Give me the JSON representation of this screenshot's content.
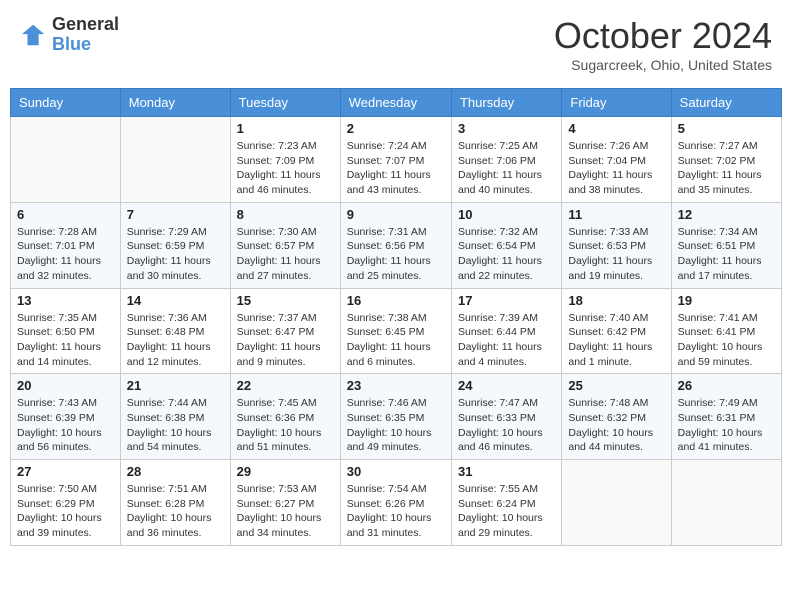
{
  "header": {
    "logo_general": "General",
    "logo_blue": "Blue",
    "title": "October 2024",
    "location": "Sugarcreek, Ohio, United States"
  },
  "days_of_week": [
    "Sunday",
    "Monday",
    "Tuesday",
    "Wednesday",
    "Thursday",
    "Friday",
    "Saturday"
  ],
  "weeks": [
    [
      {
        "day": "",
        "sunrise": "",
        "sunset": "",
        "daylight": ""
      },
      {
        "day": "",
        "sunrise": "",
        "sunset": "",
        "daylight": ""
      },
      {
        "day": "1",
        "sunrise": "Sunrise: 7:23 AM",
        "sunset": "Sunset: 7:09 PM",
        "daylight": "Daylight: 11 hours and 46 minutes."
      },
      {
        "day": "2",
        "sunrise": "Sunrise: 7:24 AM",
        "sunset": "Sunset: 7:07 PM",
        "daylight": "Daylight: 11 hours and 43 minutes."
      },
      {
        "day": "3",
        "sunrise": "Sunrise: 7:25 AM",
        "sunset": "Sunset: 7:06 PM",
        "daylight": "Daylight: 11 hours and 40 minutes."
      },
      {
        "day": "4",
        "sunrise": "Sunrise: 7:26 AM",
        "sunset": "Sunset: 7:04 PM",
        "daylight": "Daylight: 11 hours and 38 minutes."
      },
      {
        "day": "5",
        "sunrise": "Sunrise: 7:27 AM",
        "sunset": "Sunset: 7:02 PM",
        "daylight": "Daylight: 11 hours and 35 minutes."
      }
    ],
    [
      {
        "day": "6",
        "sunrise": "Sunrise: 7:28 AM",
        "sunset": "Sunset: 7:01 PM",
        "daylight": "Daylight: 11 hours and 32 minutes."
      },
      {
        "day": "7",
        "sunrise": "Sunrise: 7:29 AM",
        "sunset": "Sunset: 6:59 PM",
        "daylight": "Daylight: 11 hours and 30 minutes."
      },
      {
        "day": "8",
        "sunrise": "Sunrise: 7:30 AM",
        "sunset": "Sunset: 6:57 PM",
        "daylight": "Daylight: 11 hours and 27 minutes."
      },
      {
        "day": "9",
        "sunrise": "Sunrise: 7:31 AM",
        "sunset": "Sunset: 6:56 PM",
        "daylight": "Daylight: 11 hours and 25 minutes."
      },
      {
        "day": "10",
        "sunrise": "Sunrise: 7:32 AM",
        "sunset": "Sunset: 6:54 PM",
        "daylight": "Daylight: 11 hours and 22 minutes."
      },
      {
        "day": "11",
        "sunrise": "Sunrise: 7:33 AM",
        "sunset": "Sunset: 6:53 PM",
        "daylight": "Daylight: 11 hours and 19 minutes."
      },
      {
        "day": "12",
        "sunrise": "Sunrise: 7:34 AM",
        "sunset": "Sunset: 6:51 PM",
        "daylight": "Daylight: 11 hours and 17 minutes."
      }
    ],
    [
      {
        "day": "13",
        "sunrise": "Sunrise: 7:35 AM",
        "sunset": "Sunset: 6:50 PM",
        "daylight": "Daylight: 11 hours and 14 minutes."
      },
      {
        "day": "14",
        "sunrise": "Sunrise: 7:36 AM",
        "sunset": "Sunset: 6:48 PM",
        "daylight": "Daylight: 11 hours and 12 minutes."
      },
      {
        "day": "15",
        "sunrise": "Sunrise: 7:37 AM",
        "sunset": "Sunset: 6:47 PM",
        "daylight": "Daylight: 11 hours and 9 minutes."
      },
      {
        "day": "16",
        "sunrise": "Sunrise: 7:38 AM",
        "sunset": "Sunset: 6:45 PM",
        "daylight": "Daylight: 11 hours and 6 minutes."
      },
      {
        "day": "17",
        "sunrise": "Sunrise: 7:39 AM",
        "sunset": "Sunset: 6:44 PM",
        "daylight": "Daylight: 11 hours and 4 minutes."
      },
      {
        "day": "18",
        "sunrise": "Sunrise: 7:40 AM",
        "sunset": "Sunset: 6:42 PM",
        "daylight": "Daylight: 11 hours and 1 minute."
      },
      {
        "day": "19",
        "sunrise": "Sunrise: 7:41 AM",
        "sunset": "Sunset: 6:41 PM",
        "daylight": "Daylight: 10 hours and 59 minutes."
      }
    ],
    [
      {
        "day": "20",
        "sunrise": "Sunrise: 7:43 AM",
        "sunset": "Sunset: 6:39 PM",
        "daylight": "Daylight: 10 hours and 56 minutes."
      },
      {
        "day": "21",
        "sunrise": "Sunrise: 7:44 AM",
        "sunset": "Sunset: 6:38 PM",
        "daylight": "Daylight: 10 hours and 54 minutes."
      },
      {
        "day": "22",
        "sunrise": "Sunrise: 7:45 AM",
        "sunset": "Sunset: 6:36 PM",
        "daylight": "Daylight: 10 hours and 51 minutes."
      },
      {
        "day": "23",
        "sunrise": "Sunrise: 7:46 AM",
        "sunset": "Sunset: 6:35 PM",
        "daylight": "Daylight: 10 hours and 49 minutes."
      },
      {
        "day": "24",
        "sunrise": "Sunrise: 7:47 AM",
        "sunset": "Sunset: 6:33 PM",
        "daylight": "Daylight: 10 hours and 46 minutes."
      },
      {
        "day": "25",
        "sunrise": "Sunrise: 7:48 AM",
        "sunset": "Sunset: 6:32 PM",
        "daylight": "Daylight: 10 hours and 44 minutes."
      },
      {
        "day": "26",
        "sunrise": "Sunrise: 7:49 AM",
        "sunset": "Sunset: 6:31 PM",
        "daylight": "Daylight: 10 hours and 41 minutes."
      }
    ],
    [
      {
        "day": "27",
        "sunrise": "Sunrise: 7:50 AM",
        "sunset": "Sunset: 6:29 PM",
        "daylight": "Daylight: 10 hours and 39 minutes."
      },
      {
        "day": "28",
        "sunrise": "Sunrise: 7:51 AM",
        "sunset": "Sunset: 6:28 PM",
        "daylight": "Daylight: 10 hours and 36 minutes."
      },
      {
        "day": "29",
        "sunrise": "Sunrise: 7:53 AM",
        "sunset": "Sunset: 6:27 PM",
        "daylight": "Daylight: 10 hours and 34 minutes."
      },
      {
        "day": "30",
        "sunrise": "Sunrise: 7:54 AM",
        "sunset": "Sunset: 6:26 PM",
        "daylight": "Daylight: 10 hours and 31 minutes."
      },
      {
        "day": "31",
        "sunrise": "Sunrise: 7:55 AM",
        "sunset": "Sunset: 6:24 PM",
        "daylight": "Daylight: 10 hours and 29 minutes."
      },
      {
        "day": "",
        "sunrise": "",
        "sunset": "",
        "daylight": ""
      },
      {
        "day": "",
        "sunrise": "",
        "sunset": "",
        "daylight": ""
      }
    ]
  ]
}
